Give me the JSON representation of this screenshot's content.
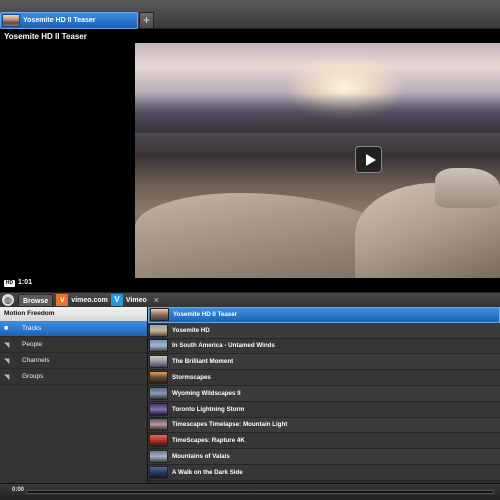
{
  "tabs": [
    {
      "label": "Yosemite HD II Teaser"
    }
  ],
  "new_tab_label": "+",
  "player": {
    "title": "Yosemite HD II Teaser",
    "hd_badge": "HD",
    "duration": "1:01"
  },
  "source_tabs": {
    "browse": "Browse",
    "vimeo_com_icon": "v",
    "vimeo_com": "vimeo.com",
    "vimeo_icon": "V",
    "vimeo": "Vimeo",
    "close": "×"
  },
  "sidebar": {
    "header": "Motion Freedom",
    "items": [
      {
        "label": "Tracks",
        "icon": "video-camera-icon",
        "glyph": "■",
        "active": true
      },
      {
        "label": "People",
        "icon": "rss-icon",
        "glyph": "◥",
        "active": false
      },
      {
        "label": "Channels",
        "icon": "rss-icon",
        "glyph": "◥",
        "active": false
      },
      {
        "label": "Groups",
        "icon": "rss-icon",
        "glyph": "◥",
        "active": false
      }
    ]
  },
  "videos": [
    {
      "title": "Yosemite HD II Teaser",
      "active": true,
      "thumb": [
        "#f3d2b0",
        "#8a6e66",
        "#4a3c3a"
      ]
    },
    {
      "title": "Yosemite HD",
      "active": false,
      "thumb": [
        "#9aa2b8",
        "#c8b8a0",
        "#5a4a3e"
      ]
    },
    {
      "title": "In South America - Untamed Winds",
      "active": false,
      "thumb": [
        "#6c8fb8",
        "#a8b8c8",
        "#3a4a5a"
      ]
    },
    {
      "title": "The Brilliant Moment",
      "active": false,
      "thumb": [
        "#d8c8b0",
        "#8a98b0",
        "#4a4450"
      ]
    },
    {
      "title": "Stormscapes",
      "active": false,
      "thumb": [
        "#e8a050",
        "#5a4a3a",
        "#2a2018"
      ]
    },
    {
      "title": "Wyoming Wildscapes II",
      "active": false,
      "thumb": [
        "#5a6a88",
        "#8a9ab0",
        "#2e3440"
      ]
    },
    {
      "title": "Toronto Lightning Storm",
      "active": false,
      "thumb": [
        "#3a3a6a",
        "#8a6aa8",
        "#1a1a30"
      ]
    },
    {
      "title": "Timescapes Timelapse: Mountain Light",
      "active": false,
      "thumb": [
        "#4a5a8a",
        "#c89888",
        "#2a2a3a"
      ]
    },
    {
      "title": "TimeScapes: Rapture 4K",
      "active": false,
      "thumb": [
        "#e87040",
        "#b03030",
        "#301818"
      ]
    },
    {
      "title": "Mountains of Valais",
      "active": false,
      "thumb": [
        "#6a7a9a",
        "#aab0c0",
        "#3a4050"
      ]
    },
    {
      "title": "A Walk on the Dark Side",
      "active": false,
      "thumb": [
        "#4a6aa0",
        "#2a3a60",
        "#101828"
      ]
    }
  ],
  "playback": {
    "current_time": "0:00",
    "progress": 0.0
  },
  "colors": {
    "accent": "#2a74cc",
    "vimeo_com_orange": "#e8732a",
    "vimeo_blue": "#1e9be0"
  }
}
